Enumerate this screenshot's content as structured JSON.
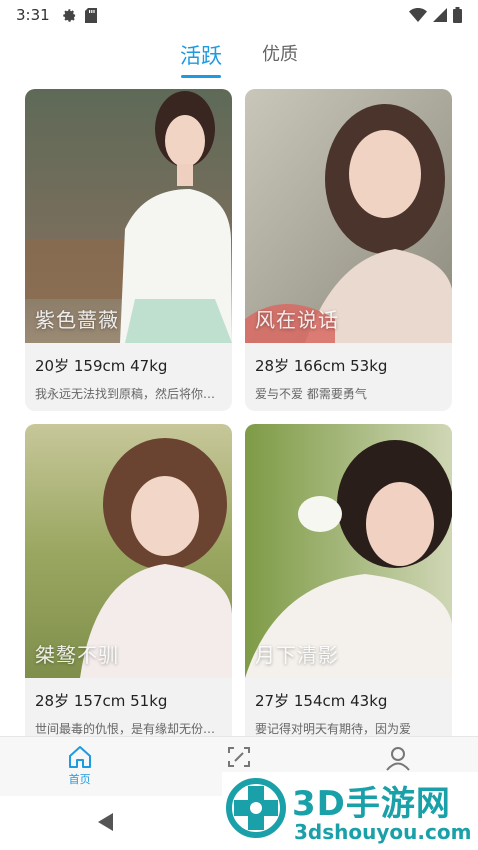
{
  "status_bar": {
    "time": "3:31"
  },
  "tabs": [
    {
      "label": "活跃",
      "active": true
    },
    {
      "label": "优质",
      "active": false
    }
  ],
  "cards": [
    {
      "name": "紫色蔷薇",
      "stats": "20岁 159cm 47kg",
      "signature": "我永远无法找到原稿，然后将你…"
    },
    {
      "name": "风在说话",
      "stats": "28岁 166cm 53kg",
      "signature": "爱与不爱 都需要勇气"
    },
    {
      "name": "桀骜不驯",
      "stats": "28岁 157cm 51kg",
      "signature": "世间最毒的仇恨，是有缘却无份…"
    },
    {
      "name": "月下清影",
      "stats": "27岁 154cm 43kg",
      "signature": "要记得对明天有期待，因为爱"
    }
  ],
  "bottom_nav": [
    {
      "label": "首页",
      "icon": "home-icon",
      "active": true
    }
  ],
  "watermark": {
    "brand": "3D手游网",
    "url": "3dshouyou.com"
  },
  "colors": {
    "accent": "#1e9ae0",
    "watermark": "#1aa0a8"
  }
}
